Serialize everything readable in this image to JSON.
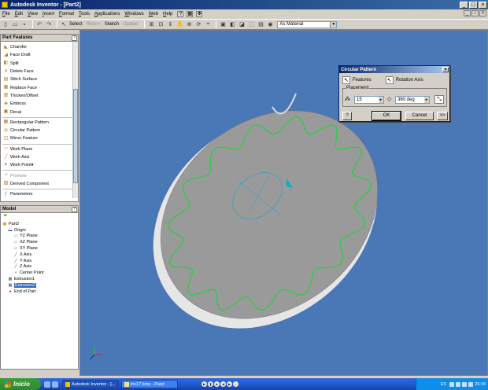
{
  "window": {
    "title": "Autodesk Inventor - [Part2]",
    "controls": [
      "_",
      "□",
      "×"
    ]
  },
  "menu": [
    "File",
    "Edit",
    "View",
    "Insert",
    "Format",
    "Tools",
    "Applications",
    "Windows",
    "Web",
    "Help"
  ],
  "toolbar": {
    "select_label": "Select",
    "return_label": "Return",
    "sketch_label": "Sketch",
    "update_label": "Update",
    "material": "As Material"
  },
  "part_features": {
    "title": "Part Features",
    "items": [
      {
        "label": "Chamfer",
        "icon": "chamfer-icon",
        "glyph": "◣",
        "disabled": false
      },
      {
        "label": "Face Draft",
        "icon": "face-draft-icon",
        "glyph": "◢",
        "disabled": false
      },
      {
        "label": "Split",
        "icon": "split-icon",
        "glyph": "◧",
        "disabled": false
      },
      {
        "label": "Delete Face",
        "icon": "delete-face-icon",
        "glyph": "✕",
        "disabled": false
      },
      {
        "label": "Stitch Surface",
        "icon": "stitch-surface-icon",
        "glyph": "▤",
        "disabled": false
      },
      {
        "label": "Replace Face",
        "icon": "replace-face-icon",
        "glyph": "▦",
        "disabled": false
      },
      {
        "label": "Thicken/Offset",
        "icon": "thicken-icon",
        "glyph": "▥",
        "disabled": false
      },
      {
        "label": "Emboss",
        "icon": "emboss-icon",
        "glyph": "◈",
        "disabled": false
      },
      {
        "label": "Decal",
        "icon": "decal-icon",
        "glyph": "▣",
        "disabled": false
      },
      {
        "label": "Rectangular Pattern",
        "icon": "rectangular-pattern-icon",
        "glyph": "▦",
        "disabled": false,
        "sep_before": true
      },
      {
        "label": "Circular Pattern",
        "icon": "circular-pattern-icon",
        "glyph": "◎",
        "disabled": false
      },
      {
        "label": "Mirror Feature",
        "icon": "mirror-icon",
        "glyph": "◫",
        "disabled": false
      },
      {
        "label": "Work Plane",
        "icon": "work-plane-icon",
        "glyph": "▱",
        "disabled": false,
        "sep_before": true
      },
      {
        "label": "Work Axis",
        "icon": "work-axis-icon",
        "glyph": "╱",
        "disabled": false
      },
      {
        "label": "Work Point",
        "icon": "work-point-icon",
        "glyph": "✦",
        "disabled": false,
        "dropdown": true
      },
      {
        "label": "Promote",
        "icon": "promote-icon",
        "glyph": "↗",
        "disabled": true,
        "sep_before": true
      },
      {
        "label": "Derived Component",
        "icon": "derived-component-icon",
        "glyph": "▧",
        "disabled": false
      },
      {
        "label": "Parameters",
        "icon": "parameters-icon",
        "glyph": "ƒ",
        "disabled": false,
        "sep_before": true
      }
    ]
  },
  "model": {
    "title": "Model",
    "tree": [
      {
        "label": "Part2",
        "depth": 0,
        "icon": "part-icon",
        "glyph": "▣"
      },
      {
        "label": "Origin",
        "depth": 1,
        "icon": "folder-icon",
        "glyph": "▬"
      },
      {
        "label": "YZ Plane",
        "depth": 2,
        "icon": "plane-icon",
        "glyph": "▱"
      },
      {
        "label": "XZ Plane",
        "depth": 2,
        "icon": "plane-icon",
        "glyph": "▱"
      },
      {
        "label": "XY Plane",
        "depth": 2,
        "icon": "plane-icon",
        "glyph": "▱"
      },
      {
        "label": "X Axis",
        "depth": 2,
        "icon": "axis-icon",
        "glyph": "╱"
      },
      {
        "label": "Y Axis",
        "depth": 2,
        "icon": "axis-icon",
        "glyph": "╱"
      },
      {
        "label": "Z Axis",
        "depth": 2,
        "icon": "axis-icon",
        "glyph": "╱"
      },
      {
        "label": "Center Point",
        "depth": 2,
        "icon": "point-icon",
        "glyph": "•"
      },
      {
        "label": "Extrusion1",
        "depth": 1,
        "icon": "extrusion-icon",
        "glyph": "▩"
      },
      {
        "label": "Extrusion2",
        "depth": 1,
        "icon": "extrusion-icon",
        "glyph": "▩",
        "selected": true
      },
      {
        "label": "End of Part",
        "depth": 1,
        "icon": "end-of-part-icon",
        "glyph": "●"
      }
    ]
  },
  "dialog": {
    "title": "Circular Pattern",
    "features_label": "Features",
    "rotation_axis_label": "Rotation Axis",
    "placement_label": "Placement",
    "count": "15",
    "angle": "360 deg",
    "ok": "OK",
    "cancel": "Cancel",
    "more": ">>"
  },
  "taskbar": {
    "start": "Inicio",
    "tasks": [
      "Autodesk Inventor - [...",
      "inv17.bmp - Paint"
    ],
    "language": "ES",
    "time": "23:19"
  },
  "colors": {
    "viewport_bg": "#4a77b5",
    "disk_face": "#9a9a9a",
    "disk_edge": "#e6e6e6",
    "tooth_green": "#2ecc40",
    "accent": "#0a246a"
  }
}
